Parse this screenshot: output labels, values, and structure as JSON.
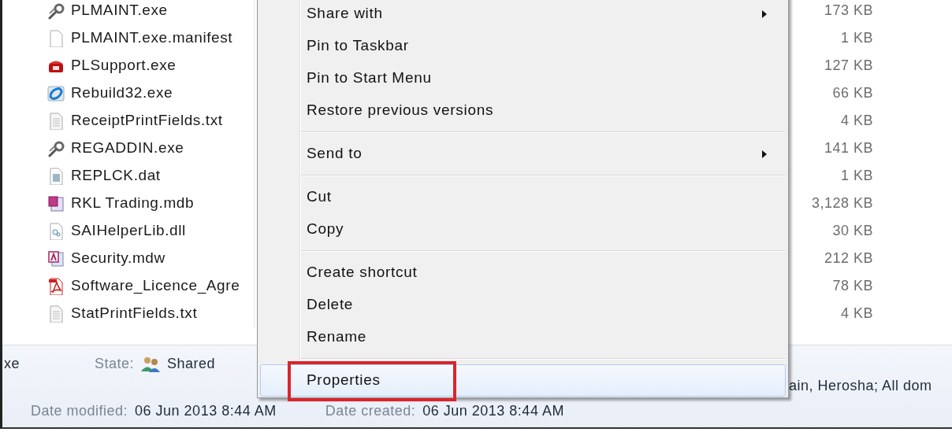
{
  "files": [
    {
      "name": "PLMAINT.exe",
      "size": "173 KB",
      "kind": "tool"
    },
    {
      "name": "PLMAINT.exe.manifest",
      "size": "1 KB",
      "kind": "blank"
    },
    {
      "name": "PLSupport.exe",
      "size": "127 KB",
      "kind": "phone"
    },
    {
      "name": "Rebuild32.exe",
      "size": "66 KB",
      "kind": "loop"
    },
    {
      "name": "ReceiptPrintFields.txt",
      "size": "4 KB",
      "kind": "text"
    },
    {
      "name": "REGADDIN.exe",
      "size": "141 KB",
      "kind": "tool"
    },
    {
      "name": "REPLCK.dat",
      "size": "1 KB",
      "kind": "data"
    },
    {
      "name": "RKL Trading.mdb",
      "size": "3,128 KB",
      "kind": "database"
    },
    {
      "name": "SAIHelperLib.dll",
      "size": "30 KB",
      "kind": "library"
    },
    {
      "name": "Security.mdw",
      "size": "212 KB",
      "kind": "access"
    },
    {
      "name": "Software_Licence_Agre",
      "size": "78 KB",
      "kind": "pdf"
    },
    {
      "name": "StatPrintFields.txt",
      "size": "4 KB",
      "kind": "text"
    }
  ],
  "menu": {
    "items": [
      {
        "kind": "item",
        "label": "Share with",
        "submenu": true,
        "selected": false,
        "annotated": false
      },
      {
        "kind": "item",
        "label": "Pin to Taskbar",
        "submenu": false,
        "selected": false,
        "annotated": false
      },
      {
        "kind": "item",
        "label": "Pin to Start Menu",
        "submenu": false,
        "selected": false,
        "annotated": false
      },
      {
        "kind": "item",
        "label": "Restore previous versions",
        "submenu": false,
        "selected": false,
        "annotated": false
      },
      {
        "kind": "separator"
      },
      {
        "kind": "item",
        "label": "Send to",
        "submenu": true,
        "selected": false,
        "annotated": false
      },
      {
        "kind": "separator"
      },
      {
        "kind": "item",
        "label": "Cut",
        "submenu": false,
        "selected": false,
        "annotated": false
      },
      {
        "kind": "item",
        "label": "Copy",
        "submenu": false,
        "selected": false,
        "annotated": false
      },
      {
        "kind": "separator"
      },
      {
        "kind": "item",
        "label": "Create shortcut",
        "submenu": false,
        "selected": false,
        "annotated": false
      },
      {
        "kind": "item",
        "label": "Delete",
        "submenu": false,
        "selected": false,
        "annotated": false
      },
      {
        "kind": "item",
        "label": "Rename",
        "submenu": false,
        "selected": false,
        "annotated": false
      },
      {
        "kind": "separator"
      },
      {
        "kind": "item",
        "label": "Properties",
        "submenu": false,
        "selected": true,
        "annotated": true
      }
    ]
  },
  "status_bar": {
    "file_name": "xe",
    "state_label": "State:",
    "state_value": "Shared",
    "shared_with": "ain, Herosha; All dom",
    "date_modified_label": "Date modified:",
    "date_modified": "06 Jun 2013 8:44 AM",
    "date_created_label": "Date created:",
    "date_created": "06 Jun 2013 8:44 AM"
  }
}
